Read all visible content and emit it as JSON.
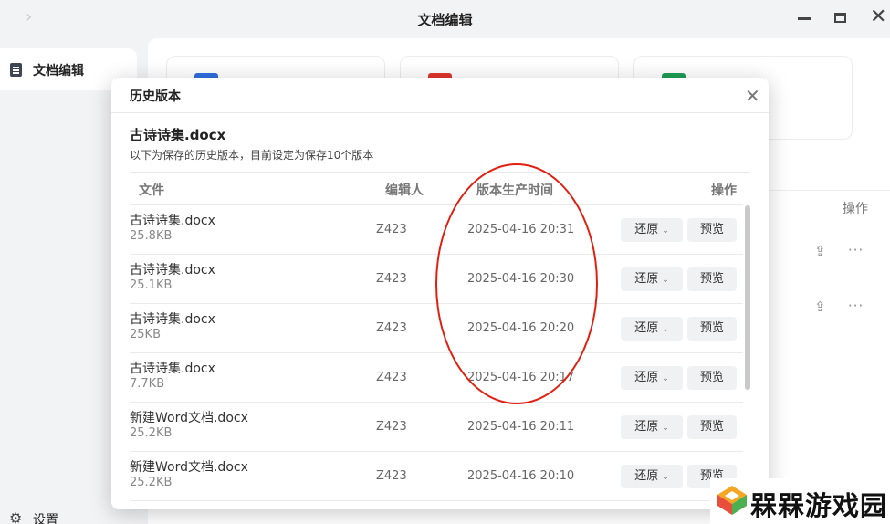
{
  "window": {
    "title": "文档编辑",
    "back_icon": "‹",
    "forward_icon": "›",
    "close_icon": "✕"
  },
  "sidebar": {
    "items": [
      {
        "label": "文档编辑"
      }
    ],
    "settings": {
      "label": "设置",
      "icon": "⚙"
    }
  },
  "background": {
    "cards": [
      {
        "icon_color": "#2f6fde"
      },
      {
        "icon_color": "#e0352d"
      },
      {
        "icon_color": "#1f9d55"
      }
    ],
    "op_label": "操作",
    "share_icon": "⇪",
    "more_icon": "···"
  },
  "dialog": {
    "title": "历史版本",
    "close_icon": "✕",
    "file_name": "古诗诗集.docx",
    "description": "以下为保存的历史版本，目前设定为保存10个版本",
    "columns": {
      "file": "文件",
      "editor": "编辑人",
      "time": "版本生产时间",
      "actions": "操作"
    },
    "restore_label": "还原",
    "restore_caret": "⌄",
    "preview_label": "预览",
    "rows": [
      {
        "name": "古诗诗集.docx",
        "size": "25.8KB",
        "editor": "Z423",
        "time": "2025-04-16 20:31"
      },
      {
        "name": "古诗诗集.docx",
        "size": "25.1KB",
        "editor": "Z423",
        "time": "2025-04-16 20:30"
      },
      {
        "name": "古诗诗集.docx",
        "size": "25KB",
        "editor": "Z423",
        "time": "2025-04-16 20:20"
      },
      {
        "name": "古诗诗集.docx",
        "size": "7.7KB",
        "editor": "Z423",
        "time": "2025-04-16 20:17"
      },
      {
        "name": "新建Word文档.docx",
        "size": "25.2KB",
        "editor": "Z423",
        "time": "2025-04-16 20:11"
      },
      {
        "name": "新建Word文档.docx",
        "size": "25.2KB",
        "editor": "Z423",
        "time": "2025-04-16 20:10"
      }
    ]
  },
  "annotation": {
    "color": "#e02010"
  },
  "watermark": {
    "text": "槑槑游戏园"
  }
}
